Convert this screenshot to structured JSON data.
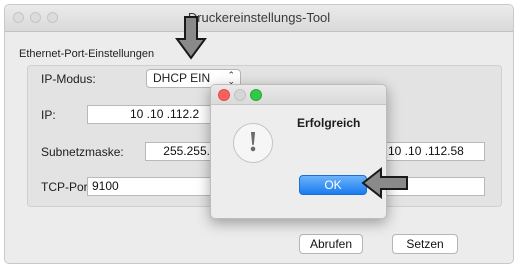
{
  "window": {
    "title": "Druckereinstellungs-Tool"
  },
  "group": {
    "label": "Ethernet-Port-Einstellungen"
  },
  "form": {
    "ip_mode_label": "IP-Modus:",
    "ip_mode_value": "DHCP EIN",
    "ip_label": "IP:",
    "ip_value": "10 .10 .112.2",
    "subnet_label": "Subnetzmaske:",
    "subnet_value": "255.255.255",
    "gateway_value": "10 .10 .112.58",
    "tcp_port_label": "TCP-Port:",
    "tcp_port_value": "9100",
    "extra_field_value": ""
  },
  "buttons": {
    "fetch_label": "Abrufen",
    "set_label": "Setzen"
  },
  "dialog": {
    "message": "Erfolgreich",
    "ok_label": "OK",
    "icon": "exclamation-icon"
  },
  "colors": {
    "accent": "#1b7bf0",
    "close": "#fc605c",
    "minimize": "#fdbc40",
    "zoom": "#34c84a"
  }
}
